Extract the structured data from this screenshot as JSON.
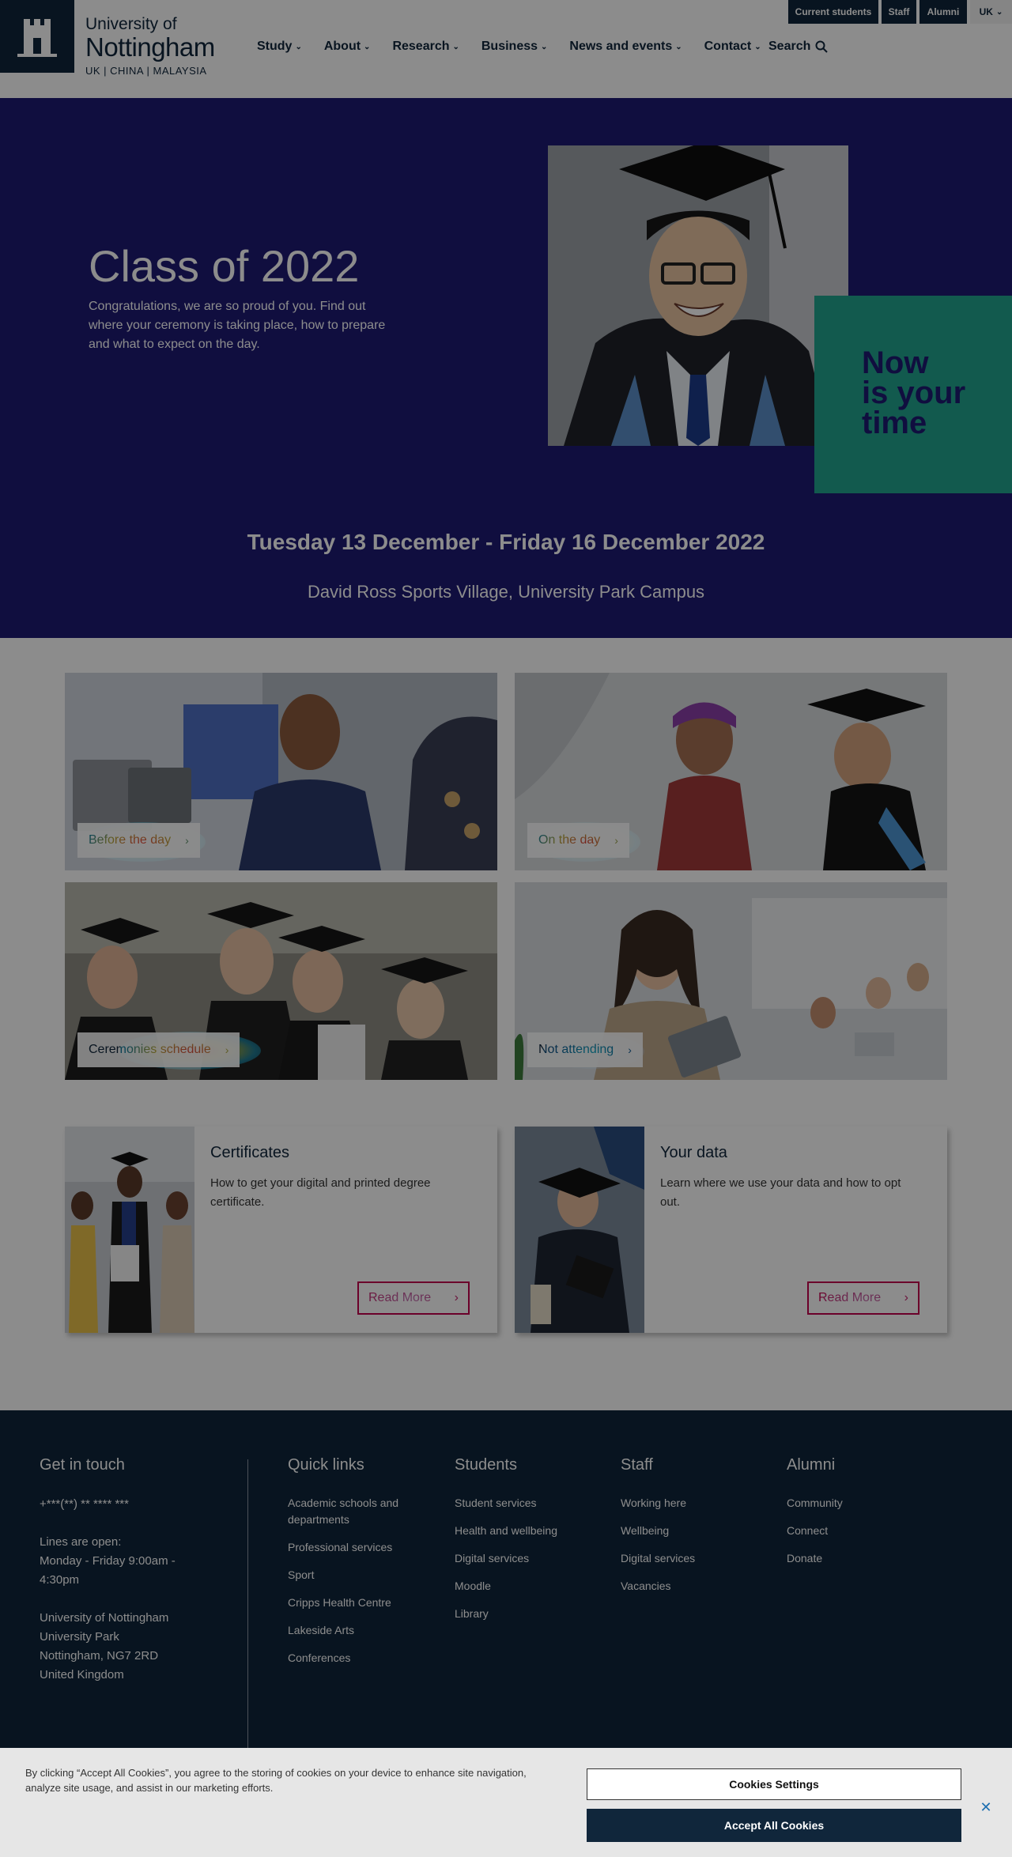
{
  "header": {
    "logo": {
      "line1": "University of",
      "line2": "Nottingham",
      "line3": "UK | CHINA | MALAYSIA"
    },
    "nav": [
      {
        "label": "Study"
      },
      {
        "label": "About"
      },
      {
        "label": "Research"
      },
      {
        "label": "Business"
      },
      {
        "label": "News and events"
      },
      {
        "label": "Contact"
      }
    ],
    "search_label": "Search",
    "utility": {
      "current_students": "Current students",
      "staff": "Staff",
      "alumni": "Alumni",
      "region": "UK"
    }
  },
  "hero": {
    "title": "Class of 2022",
    "subtitle": "Congratulations, we are so proud of you. Find out where your ceremony is taking place, how to prepare and what to expect on the day.",
    "badge_line1": "Now",
    "badge_line2": "is your",
    "badge_line3": "time",
    "dates": "Tuesday 13 December - Friday 16 December 2022",
    "venue": "David Ross Sports Village, University Park Campus"
  },
  "tiles": [
    {
      "label": "Before the day"
    },
    {
      "label": "On the day"
    },
    {
      "label": "Ceremonies schedule"
    },
    {
      "label": "Not attending"
    }
  ],
  "cards": [
    {
      "title": "Certificates",
      "description": "How to get your digital and printed degree certificate.",
      "button": "Read More"
    },
    {
      "title": "Your data",
      "description": "Learn where we use your data and how to opt out.",
      "button": "Read More"
    }
  ],
  "footer": {
    "contact": {
      "heading": "Get in touch",
      "phone": "+***(**) ** **** ***",
      "hours_label": "Lines are open:",
      "hours": "Monday - Friday 9:00am - 4:30pm",
      "address": [
        "University of Nottingham",
        "University Park",
        "Nottingham, NG7 2RD",
        "United Kingdom"
      ]
    },
    "quick_links": {
      "heading": "Quick links",
      "items": [
        "Academic schools and departments",
        "Professional services",
        "Sport",
        "Cripps Health Centre",
        "Lakeside Arts",
        "Conferences"
      ]
    },
    "students": {
      "heading": "Students",
      "items": [
        "Student services",
        "Health and wellbeing",
        "Digital services",
        "Moodle",
        "Library"
      ]
    },
    "staff": {
      "heading": "Staff",
      "items": [
        "Working here",
        "Wellbeing",
        "Digital services",
        "Vacancies"
      ]
    },
    "alumni": {
      "heading": "Alumni",
      "items": [
        "Community",
        "Connect",
        "Donate"
      ]
    }
  },
  "cookie_banner": {
    "text": "By clicking “Accept All Cookies”, you agree to the storing of cookies on your device to enhance site navigation, analyze site usage, and assist in our marketing efforts.",
    "settings_button": "Cookies Settings",
    "accept_button": "Accept All Cookies"
  },
  "colors": {
    "brand_navy": "#10263b",
    "hero_purple": "#1e1a74",
    "accent_green": "#21a58e",
    "accent_pink": "#c4004e"
  },
  "icons": [
    "castle-crest-icon",
    "chevron-down-icon",
    "search-icon",
    "chevron-right-icon",
    "close-icon"
  ]
}
